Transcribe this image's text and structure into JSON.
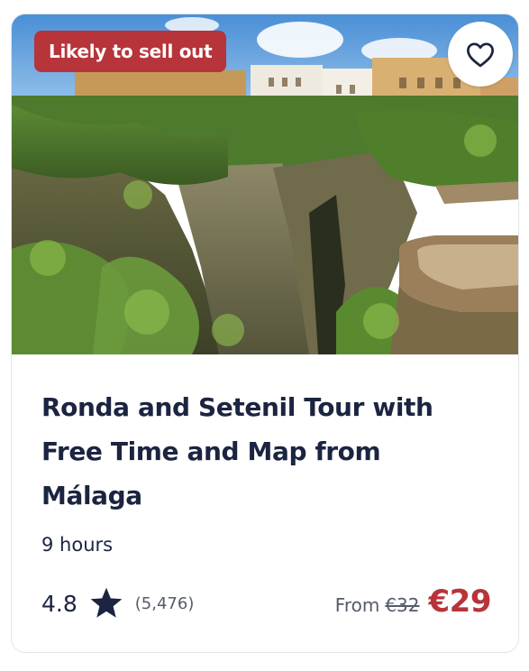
{
  "card": {
    "badge": "Likely to sell out",
    "favorite_icon": "heart-outline-icon",
    "title": "Ronda and Setenil Tour with Free Time and Map from Málaga",
    "duration": "9 hours",
    "rating": "4.8",
    "rating_icon": "star-icon",
    "reviews": "(5,476)",
    "price_prefix": "From",
    "old_price": "€32",
    "price": "€29"
  },
  "colors": {
    "accent": "#b6343a",
    "text_primary": "#1b2440",
    "text_secondary": "#555b6b",
    "border": "#e2e4e8"
  }
}
